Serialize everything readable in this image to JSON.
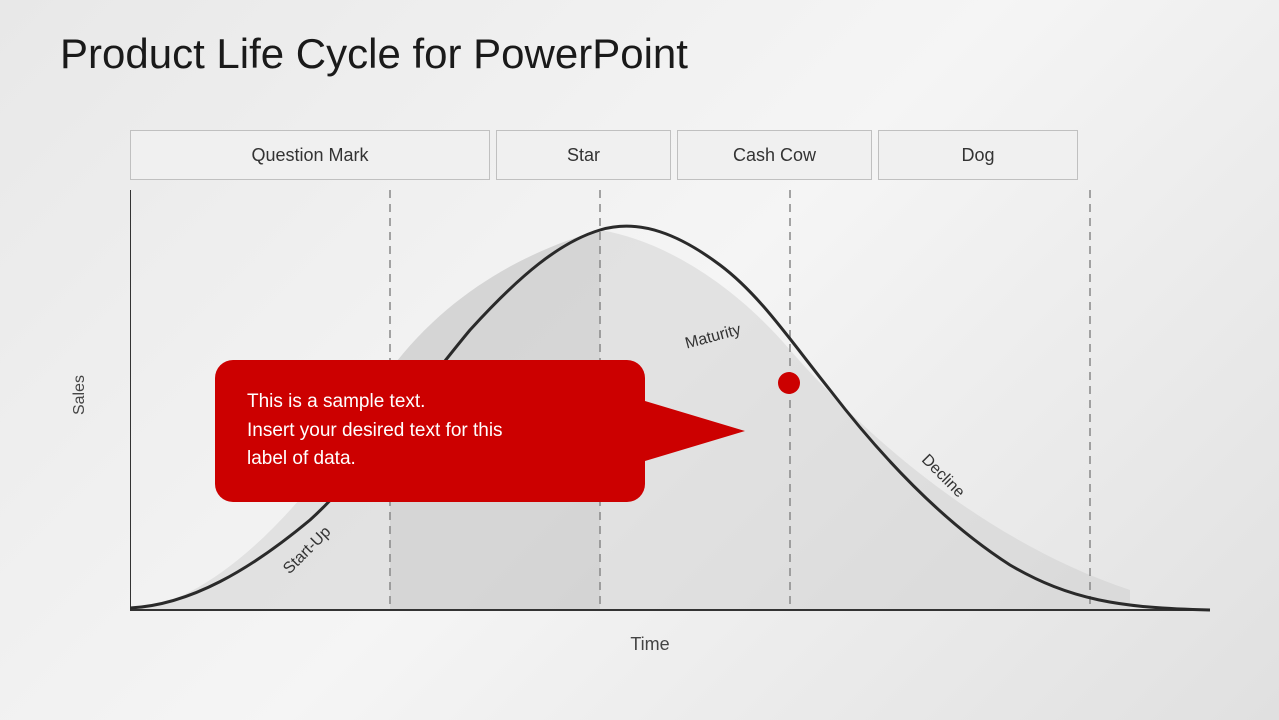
{
  "title": "Product Life Cycle for PowerPoint",
  "phases": [
    {
      "id": "question-mark",
      "label": "Question Mark"
    },
    {
      "id": "star",
      "label": "Star"
    },
    {
      "id": "cash-cow",
      "label": "Cash Cow"
    },
    {
      "id": "dog",
      "label": "Dog"
    }
  ],
  "y_axis_label": "Sales",
  "x_axis_label": "Time",
  "curve_labels": {
    "startup": "Start-Up",
    "maturity": "Maturity",
    "decline": "Decline"
  },
  "callout": {
    "line1": "This is a sample text.",
    "line2": "Insert your desired text for this",
    "line3": "label of data."
  },
  "colors": {
    "background": "#e8e8e8",
    "curve": "#2a2a2a",
    "shading": "#c0c0c0",
    "callout": "#cc0000",
    "text": "#1a1a1a"
  }
}
